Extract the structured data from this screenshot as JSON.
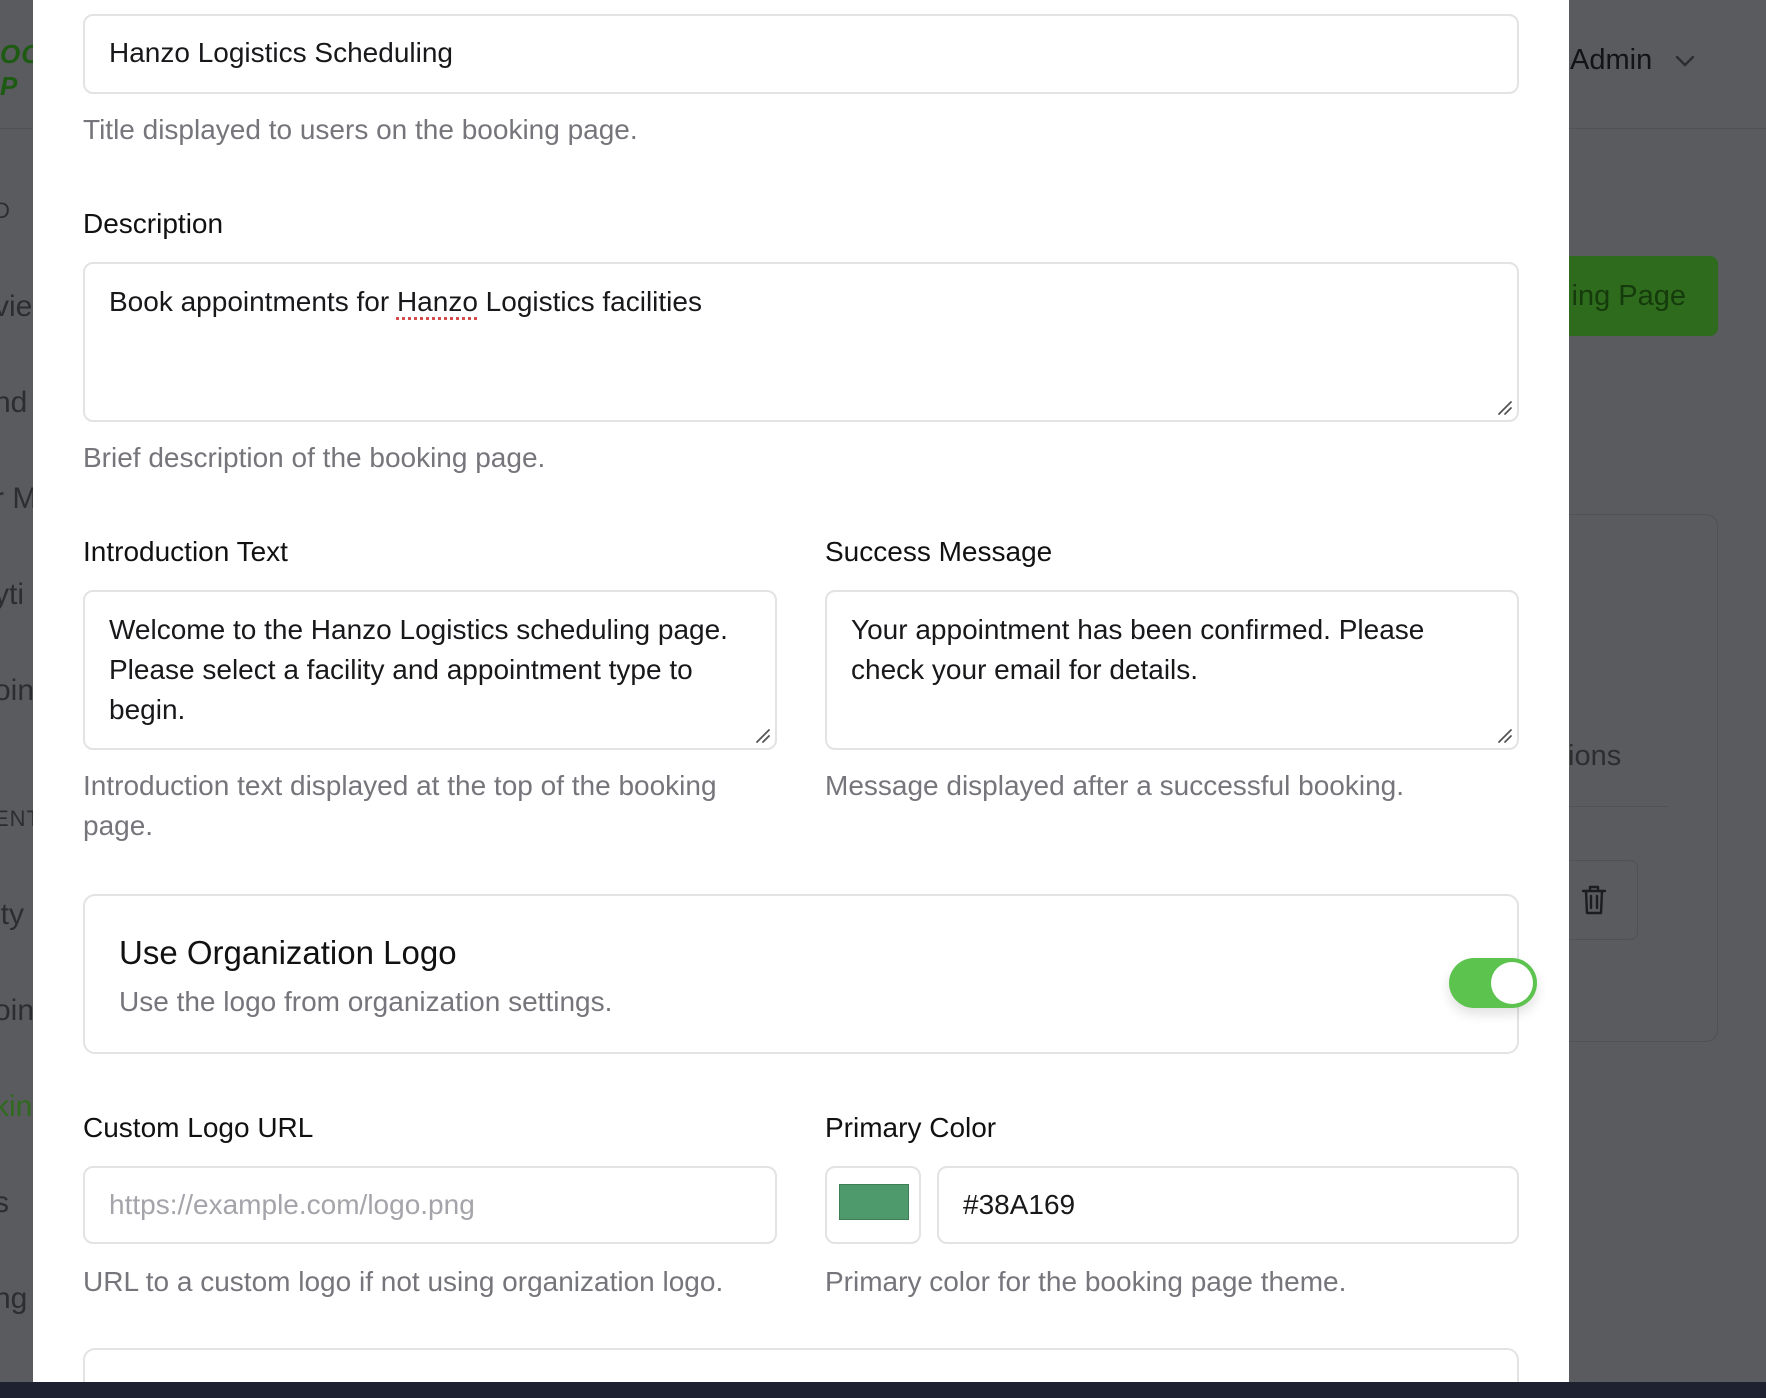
{
  "background": {
    "logo": "OO\nP",
    "user_label": "Admin",
    "sidebar_items": [
      {
        "label": "D"
      },
      {
        "label": "vie"
      },
      {
        "label": "nd"
      },
      {
        "label": "r M"
      },
      {
        "label": "yti"
      },
      {
        "label": "oin"
      },
      {
        "label": "ENT"
      },
      {
        "label": "ity"
      },
      {
        "label": "oin"
      },
      {
        "label": "kin"
      },
      {
        "label": "s"
      },
      {
        "label": "ng"
      }
    ],
    "primary_button": "ing Page",
    "card_tab": "tions"
  },
  "form": {
    "title": {
      "value": "Hanzo Logistics Scheduling",
      "help": "Title displayed to users on the booking page."
    },
    "description": {
      "label": "Description",
      "value_before": "Book appointments for ",
      "value_misspelled": "Hanzo",
      "value_after": " Logistics facilities",
      "help": "Brief description of the booking page."
    },
    "introduction": {
      "label": "Introduction Text",
      "value": "Welcome to the Hanzo Logistics scheduling page. Please select a facility and appointment type to begin.",
      "help": "Introduction text displayed at the top of the booking page."
    },
    "success": {
      "label": "Success Message",
      "value": "Your appointment has been confirmed. Please check your email for details.",
      "help": "Message displayed after a successful booking."
    },
    "org_logo": {
      "title": "Use Organization Logo",
      "description": "Use the logo from organization settings.",
      "enabled": true
    },
    "custom_logo": {
      "label": "Custom Logo URL",
      "placeholder": "https://example.com/logo.png",
      "help": "URL to a custom logo if not using organization logo."
    },
    "primary_color": {
      "label": "Primary Color",
      "value": "#38A169",
      "swatch_color": "#4f9a6c",
      "help": "Primary color for the booking page theme."
    }
  }
}
